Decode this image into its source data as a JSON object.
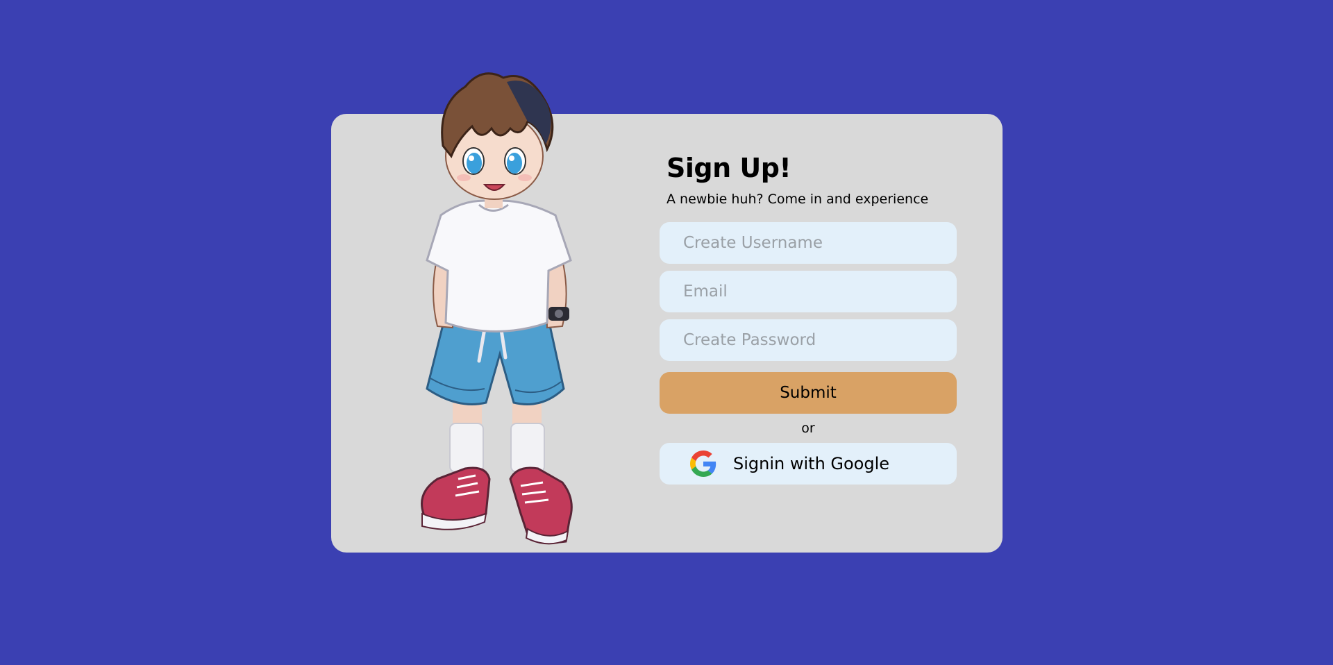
{
  "form": {
    "title": "Sign Up!",
    "subtitle": "A newbie huh? Come in and experience",
    "username_placeholder": "Create Username",
    "email_placeholder": "Email",
    "password_placeholder": "Create Password",
    "submit_label": "Submit",
    "or_label": "or",
    "google_label": "Signin with Google"
  },
  "colors": {
    "background": "#3b40b2",
    "card": "#d9d9d9",
    "input_bg": "#e3f0fa",
    "submit_bg": "#d9a265"
  },
  "icons": {
    "google": "google-g-logo"
  }
}
